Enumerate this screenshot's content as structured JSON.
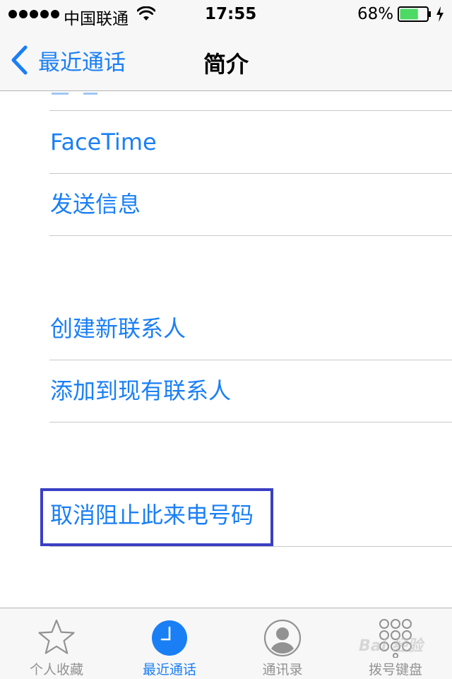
{
  "status_bar": {
    "carrier": "中国联通",
    "time": "17:55",
    "battery_percent": "68%",
    "battery_level": 0.68,
    "battery_color": "#4cd964",
    "signal_bars": 5
  },
  "nav": {
    "back_label": "最近通话",
    "title": "简介"
  },
  "actions": {
    "facetime": "FaceTime",
    "send_message": "发送信息",
    "create_contact": "创建新联系人",
    "add_to_existing": "添加到现有联系人",
    "unblock_caller": "取消阻止此来电号码"
  },
  "tabs": [
    {
      "label": "个人收藏",
      "icon": "star-icon",
      "active": false
    },
    {
      "label": "最近通话",
      "icon": "clock-icon",
      "active": true
    },
    {
      "label": "通讯录",
      "icon": "contacts-icon",
      "active": false
    },
    {
      "label": "拨号键盘",
      "icon": "keypad-icon",
      "active": false
    }
  ],
  "colors": {
    "accent": "#1a7ff5",
    "highlight_border": "#3a3fc4",
    "inactive_tab": "#929292"
  },
  "watermark": "Bai 经验"
}
